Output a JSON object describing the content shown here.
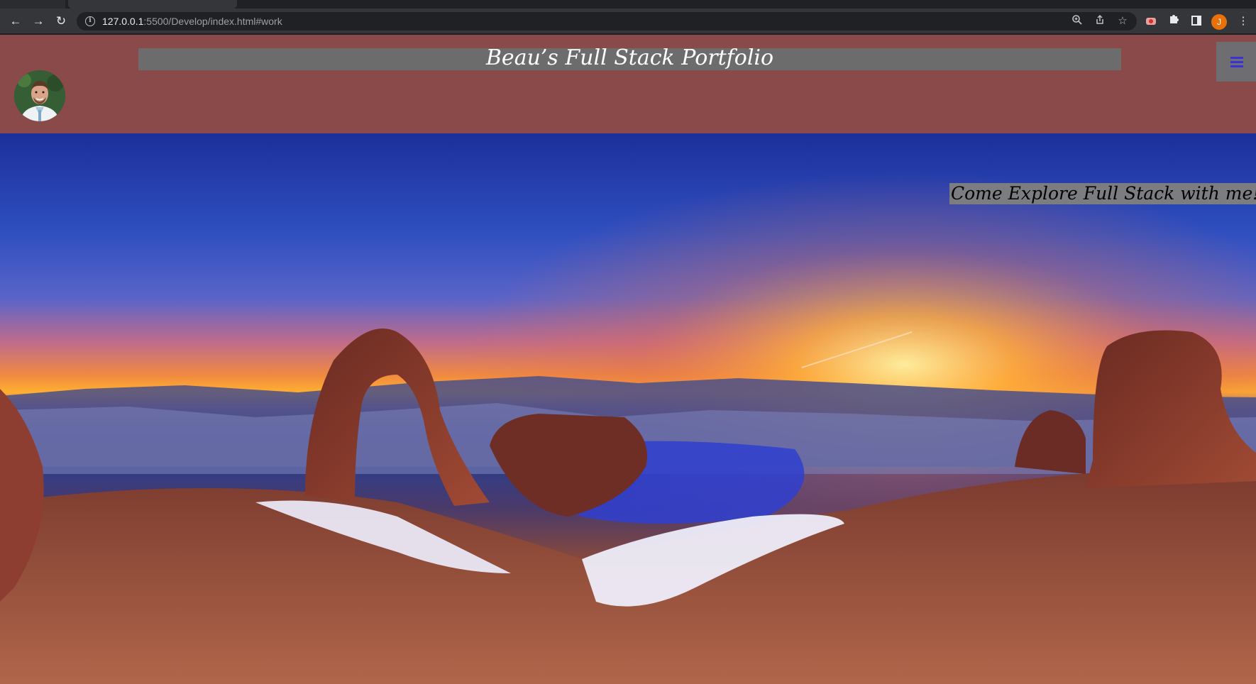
{
  "browser": {
    "url_host": "127.0.0.1",
    "url_path": ":5500/Develop/index.html#work",
    "profile_initial": "J"
  },
  "header": {
    "title": "Beau’s Full Stack Portfolio"
  },
  "hero": {
    "tagline": "Come Explore Full Stack with me!"
  },
  "colors": {
    "header_bg": "#8a4a4a",
    "title_bar_bg": "#6c6c6c",
    "menu_icon": "#3b32d6"
  },
  "icons": [
    "back-arrow-icon",
    "forward-arrow-icon",
    "reload-icon",
    "info-icon",
    "zoom-icon",
    "share-icon",
    "star-icon",
    "record-icon",
    "puzzle-icon",
    "side-panel-icon",
    "more-vert-icon",
    "hamburger-menu-icon"
  ]
}
